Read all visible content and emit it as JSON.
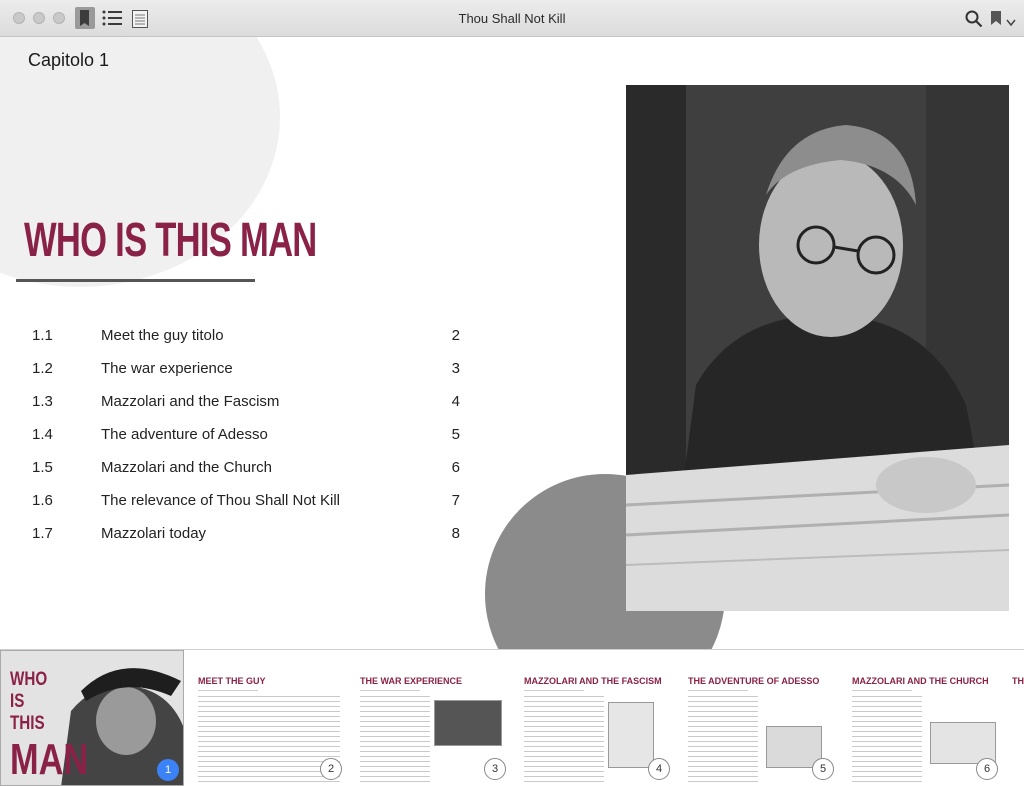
{
  "window": {
    "title": "Thou Shall Not Kill"
  },
  "toolbar": {
    "icons": [
      "close-button",
      "minimize-button",
      "zoom-button",
      "library-icon",
      "toc-list-icon",
      "notes-icon",
      "search-icon",
      "bookmark-icon",
      "chevron-down-icon"
    ]
  },
  "page": {
    "chapter": "Capitolo 1",
    "headline": "WHO IS THIS MAN",
    "toc": [
      {
        "num": "1.1",
        "title": "Meet the guy titolo",
        "page": "2"
      },
      {
        "num": "1.2",
        "title": "The war experience",
        "page": "3"
      },
      {
        "num": "1.3",
        "title": "Mazzolari and the Fascism",
        "page": "4"
      },
      {
        "num": "1.4",
        "title": "The adventure of Adesso",
        "page": "5"
      },
      {
        "num": "1.5",
        "title": "Mazzolari and the Church",
        "page": "6"
      },
      {
        "num": "1.6",
        "title": "The relevance of Thou Shall Not Kill",
        "page": "7"
      },
      {
        "num": "1.7",
        "title": "Mazzolari today",
        "page": "8"
      }
    ]
  },
  "colors": {
    "accent": "#8a2146",
    "active_page": "#3b82f6"
  },
  "thumbnails": {
    "cover": {
      "lines": [
        "WHO",
        "IS",
        "THIS",
        "MAN"
      ],
      "page": "1"
    },
    "pages": [
      {
        "title": "MEET THE GUY",
        "page": "2"
      },
      {
        "title": "THE WAR EXPERIENCE",
        "page": "3"
      },
      {
        "title": "MAZZOLARI AND THE FASCISM",
        "page": "4"
      },
      {
        "title": "THE ADVENTURE OF ADESSO",
        "page": "5"
      },
      {
        "title": "MAZZOLARI AND THE CHURCH",
        "page": "6"
      },
      {
        "title": "THE",
        "page": ""
      }
    ]
  }
}
